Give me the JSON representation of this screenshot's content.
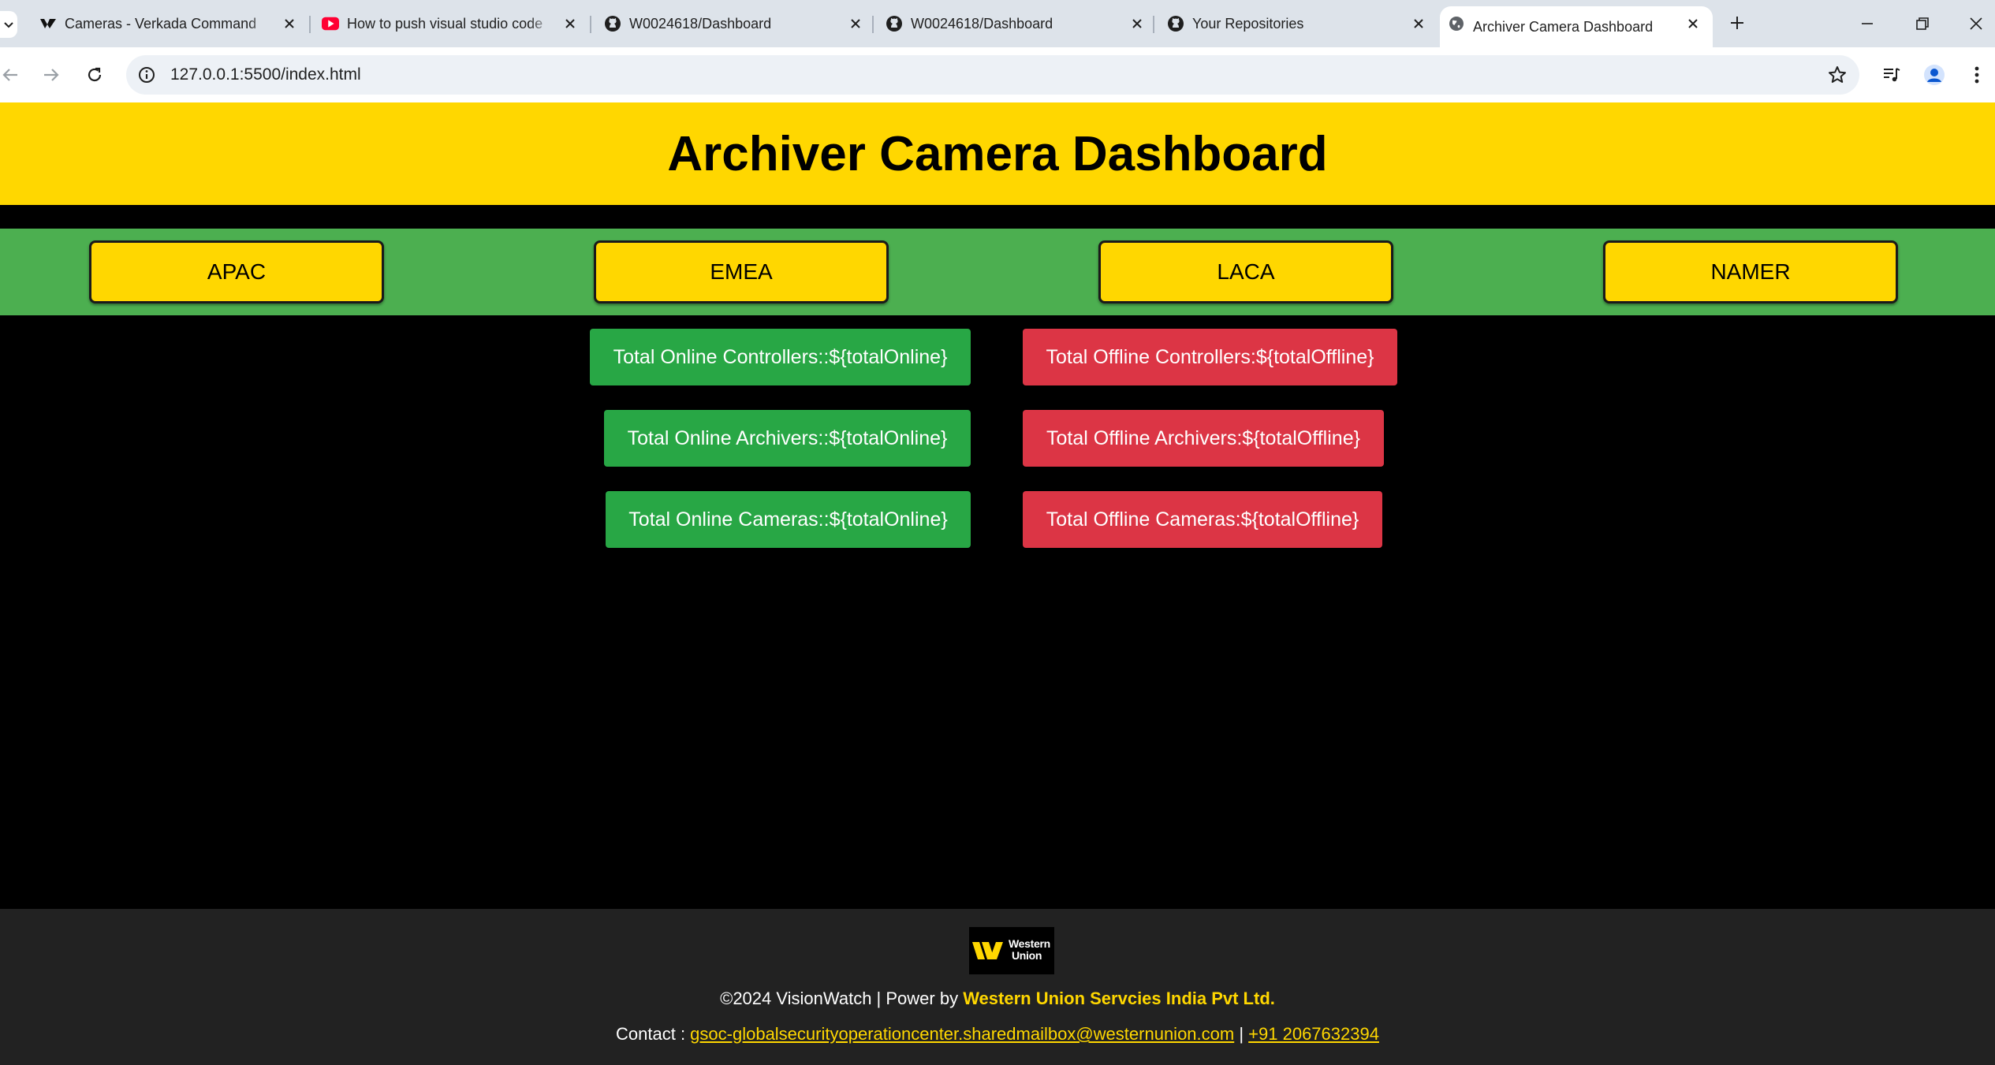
{
  "browser": {
    "tabs": [
      {
        "title": "Cameras - Verkada Command",
        "favicon": "verkada-icon"
      },
      {
        "title": "How to push visual studio code",
        "favicon": "youtube-icon"
      },
      {
        "title": "W0024618/Dashboard",
        "favicon": "github-icon"
      },
      {
        "title": "W0024618/Dashboard",
        "favicon": "github-icon"
      },
      {
        "title": "Your Repositories",
        "favicon": "github-icon"
      },
      {
        "title": "Archiver Camera Dashboard",
        "favicon": "globe-icon",
        "active": true
      }
    ],
    "url": "127.0.0.1:5500/index.html"
  },
  "header": {
    "title": "Archiver Camera Dashboard"
  },
  "regions": [
    "APAC",
    "EMEA",
    "LACA",
    "NAMER"
  ],
  "stats": {
    "online_controllers": "Total Online Controllers::${totalOnline}",
    "offline_controllers": "Total Offline Controllers:${totalOffline}",
    "online_archivers": "Total Online Archivers::${totalOnline}",
    "offline_archivers": "Total Offline Archivers:${totalOffline}",
    "online_cameras": "Total Online Cameras::${totalOnline}",
    "offline_cameras": "Total Offline Cameras:${totalOffline}"
  },
  "footer": {
    "logo_text_line1": "Western",
    "logo_text_line2": "Union",
    "copyright_prefix": "©2024 VisionWatch | Power by ",
    "company": "Western Union Servcies India Pvt Ltd.",
    "contact_label": "Contact : ",
    "email": "gsoc-globalsecurityoperationcenter.sharedmailbox@westernunion.com",
    "separator": " | ",
    "phone": "+91 2067632394"
  },
  "colors": {
    "brand_yellow": "#ffd700",
    "nav_green": "#4caf50",
    "online_green": "#28a745",
    "offline_red": "#dc3545",
    "footer_bg": "#222222"
  }
}
